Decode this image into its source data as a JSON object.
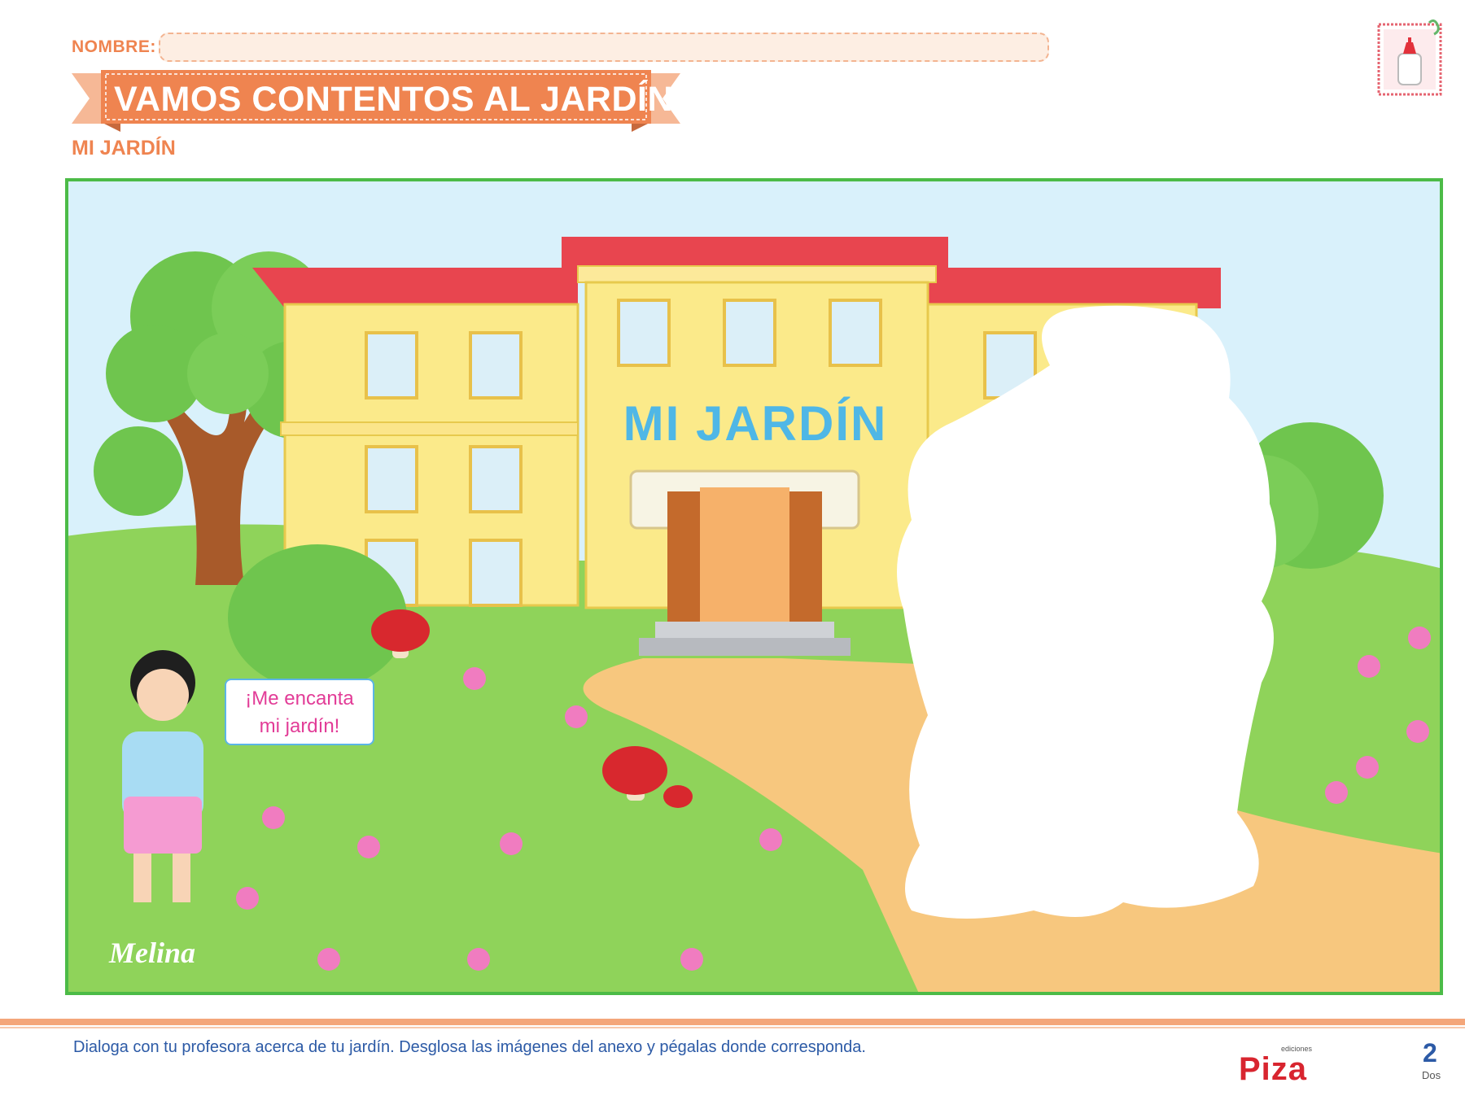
{
  "header": {
    "name_label": "NOMBRE:",
    "name_value": "",
    "title": "VAMOS CONTENTOS AL JARDÍN",
    "subtitle": "MI JARDÍN",
    "glue_icon": "glue-bottle-icon"
  },
  "scene": {
    "school_sign": "MI JARDÍN",
    "speech_bubble": [
      "¡Me encanta",
      "mi jardín!"
    ],
    "character_name": "Melina"
  },
  "footer": {
    "instruction": "Dialoga con tu profesora acerca de tu jardín. Desglosa las imágenes del anexo y pégalas donde corresponda.",
    "publisher_small": "ediciones",
    "publisher": "Piza",
    "page_number": "2",
    "page_word": "Dos"
  },
  "colors": {
    "accent": "#ef8450",
    "frame_green": "#4cbb47",
    "grass": "#8fd35a",
    "sky": "#d9f1fb",
    "building": "#fbea8a",
    "roof": "#e8454f",
    "text_blue": "#2c5aa6"
  }
}
